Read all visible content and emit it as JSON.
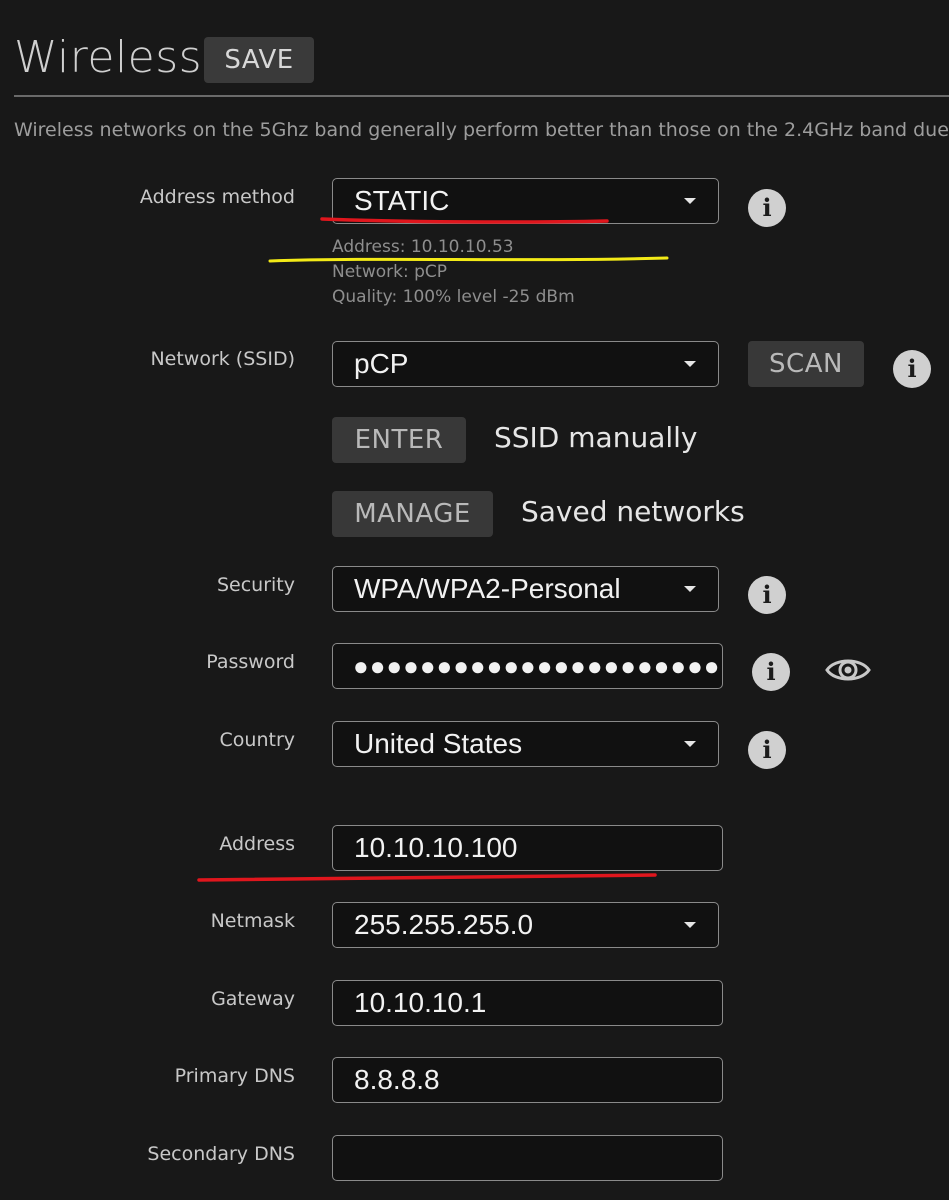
{
  "header": {
    "title": "Wireless",
    "save_label": "SAVE",
    "description": "Wireless networks on the 5Ghz band generally perform better than those on the 2.4GHz band due"
  },
  "address_method": {
    "label": "Address method",
    "value": "STATIC",
    "info_address": "Address: 10.10.10.53",
    "info_network": "Network: pCP",
    "info_quality": "Quality: 100% level -25 dBm"
  },
  "ssid": {
    "label": "Network (SSID)",
    "value": "pCP",
    "scan_label": "SCAN",
    "enter_label": "ENTER",
    "enter_caption": "SSID manually",
    "manage_label": "MANAGE",
    "manage_caption": "Saved networks"
  },
  "security": {
    "label": "Security",
    "value": "WPA/WPA2-Personal"
  },
  "password": {
    "label": "Password",
    "value": "●●●●●●●●●●●●●●●●●●●●●●●●"
  },
  "country": {
    "label": "Country",
    "value": "United States"
  },
  "address": {
    "label": "Address",
    "value": "10.10.10.100"
  },
  "netmask": {
    "label": "Netmask",
    "value": "255.255.255.0"
  },
  "gateway": {
    "label": "Gateway",
    "value": "10.10.10.1"
  },
  "primary_dns": {
    "label": "Primary DNS",
    "value": "8.8.8.8"
  },
  "secondary_dns": {
    "label": "Secondary DNS",
    "value": ""
  },
  "icons": {
    "info": "info-icon",
    "eye": "eye-icon",
    "dropdown": "chevron-down-icon"
  },
  "colors": {
    "background": "#181818",
    "annotation_red": "#e0161d",
    "annotation_yellow": "#f3ea17"
  }
}
